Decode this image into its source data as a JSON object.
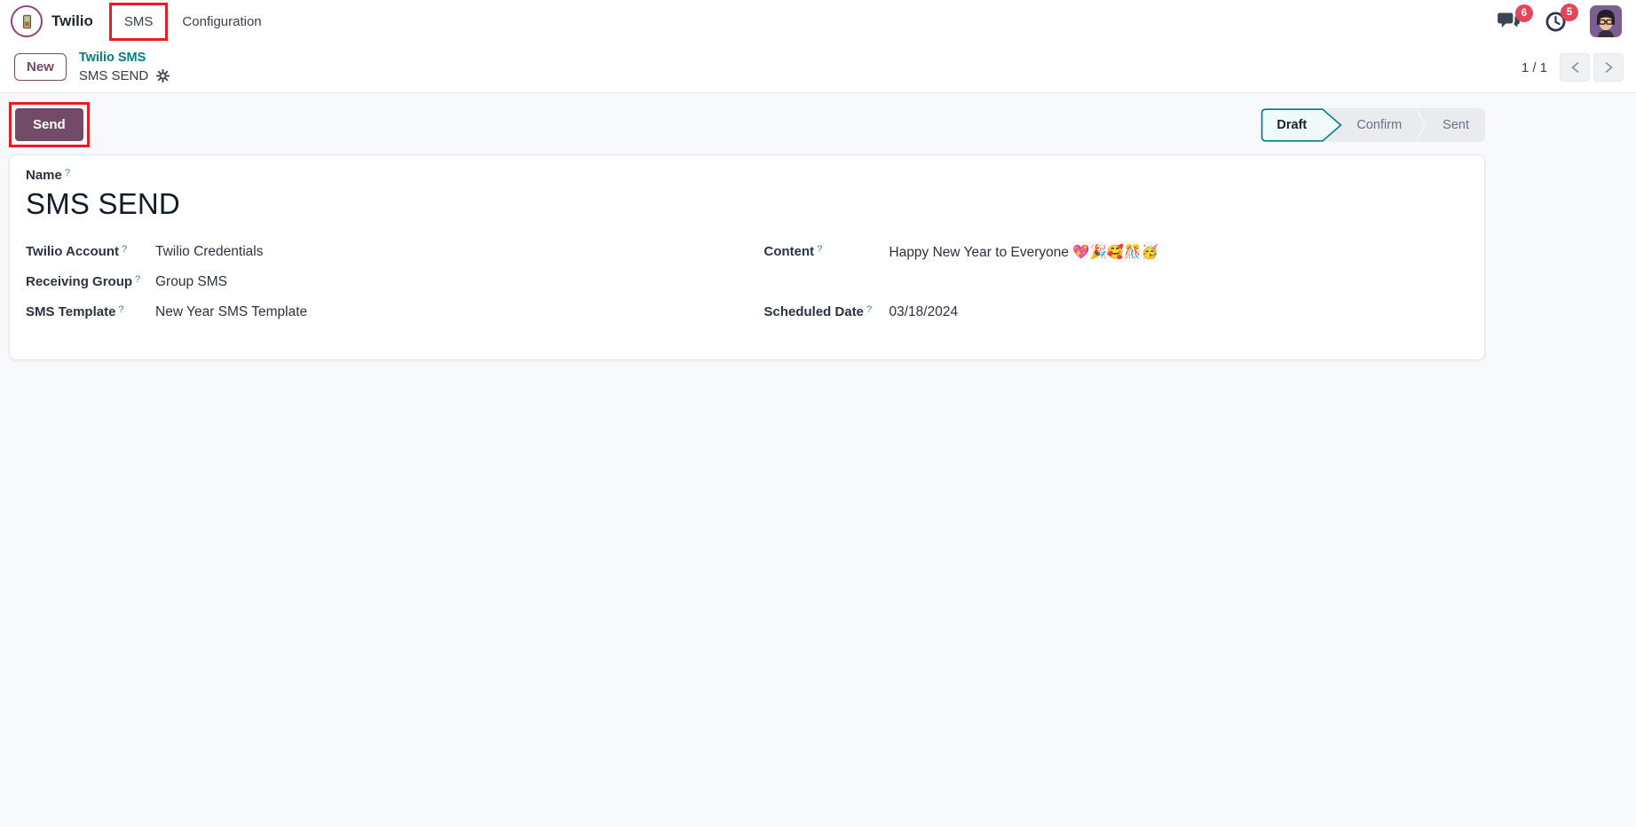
{
  "colors": {
    "brand_purple": "#714B67",
    "link_teal": "#017E84",
    "annotation_red": "#EC1C24",
    "badge_red": "#E5455A",
    "page_background": "#F8F9FB"
  },
  "navbar": {
    "app_name": "Twilio",
    "menu_sms": "SMS",
    "menu_configuration": "Configuration",
    "messages_badge": "6",
    "activities_badge": "5"
  },
  "control_panel": {
    "new_button": "New",
    "breadcrumb_parent": "Twilio SMS",
    "breadcrumb_current": "SMS SEND",
    "pager_value": "1 / 1"
  },
  "form": {
    "send_button": "Send",
    "statusbar": [
      "Draft",
      "Confirm",
      "Sent"
    ],
    "active_status": "Draft",
    "help_marker": "?",
    "name_label": "Name",
    "name_value": "SMS SEND",
    "rows_left": [
      {
        "label": "Twilio Account",
        "value": "Twilio Credentials"
      },
      {
        "label": "Receiving Group",
        "value": "Group SMS"
      },
      {
        "label": "SMS Template",
        "value": "New Year SMS Template"
      }
    ],
    "rows_right": [
      {
        "label": "Content",
        "value": "Happy New Year to Everyone 💖🎉🥰🎊🥳"
      },
      {
        "label": "Scheduled Date",
        "value": "03/18/2024"
      }
    ]
  }
}
